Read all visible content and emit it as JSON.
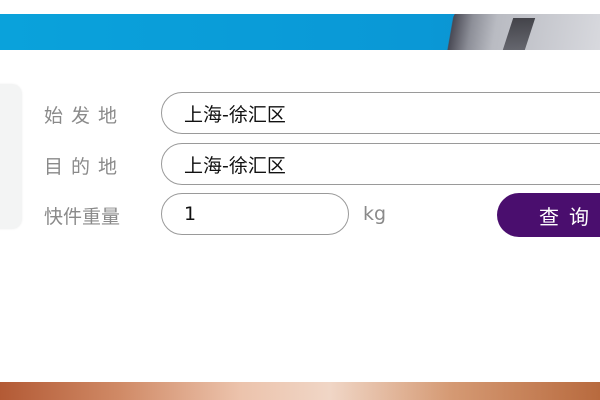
{
  "form": {
    "origin": {
      "label": "始发地",
      "value": "上海-徐汇区"
    },
    "destination": {
      "label": "目的地",
      "value": "上海-徐汇区"
    },
    "weight": {
      "label": "快件重量",
      "value": "1",
      "unit": "kg"
    },
    "query_label": "查询"
  },
  "colors": {
    "banner_blue": "#0aa2db",
    "button_purple": "#4a0e6e",
    "label_gray": "#8a8a8a"
  }
}
